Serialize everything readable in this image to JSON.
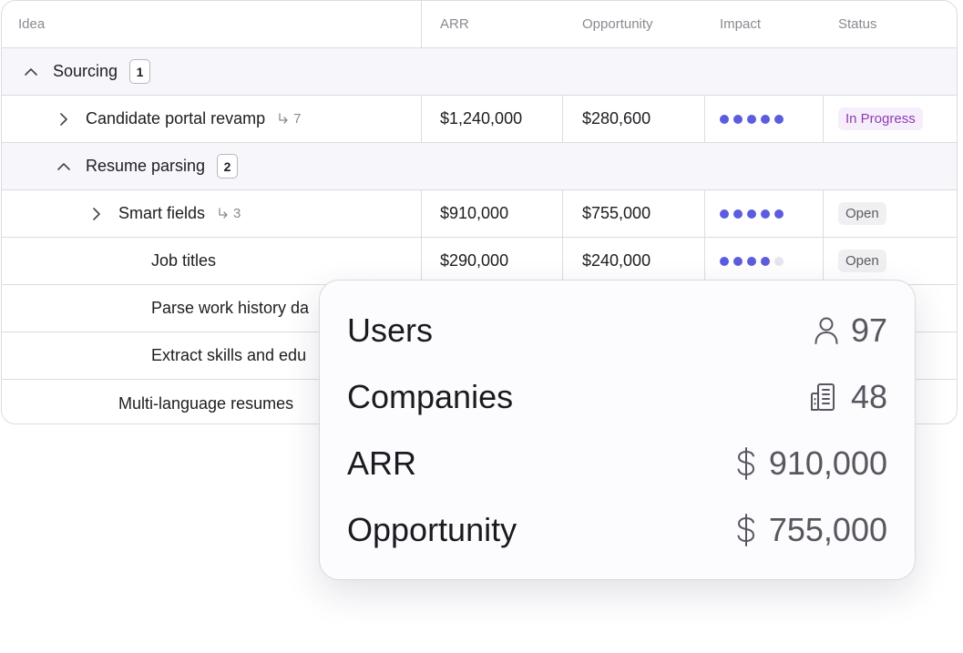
{
  "columns": {
    "idea": "Idea",
    "arr": "ARR",
    "opportunity": "Opportunity",
    "impact": "Impact",
    "status": "Status"
  },
  "rows": [
    {
      "type": "group",
      "label": "Sourcing",
      "count": "1",
      "expanded": true
    },
    {
      "type": "item",
      "label": "Candidate portal revamp",
      "subcount": "7",
      "arr": "$1,240,000",
      "opportunity": "$280,600",
      "impact": 5,
      "status": "In Progress"
    },
    {
      "type": "group",
      "label": "Resume parsing",
      "count": "2",
      "expanded": true
    },
    {
      "type": "item",
      "label": "Smart fields",
      "subcount": "3",
      "arr": "$910,000",
      "opportunity": "$755,000",
      "impact": 5,
      "status": "Open"
    },
    {
      "type": "item",
      "label": "Job titles",
      "arr": "$290,000",
      "opportunity": "$240,000",
      "impact": 4,
      "status": "Open"
    },
    {
      "type": "item",
      "label": "Parse work history da"
    },
    {
      "type": "item",
      "label": "Extract skills and edu"
    },
    {
      "type": "item",
      "label": "Multi-language resumes"
    }
  ],
  "popover": {
    "users_label": "Users",
    "users_value": "97",
    "users_icon": "user-icon",
    "companies_label": "Companies",
    "companies_value": "48",
    "companies_icon": "building-icon",
    "arr_label": "ARR",
    "arr_value": "910,000",
    "arr_icon": "dollar-icon",
    "opportunity_label": "Opportunity",
    "opportunity_value": "755,000",
    "opportunity_icon": "dollar-icon"
  },
  "colors": {
    "impact_dot": "#5b5ce0",
    "impact_dot_off": "#e5e4ef",
    "status_in_progress": "#8f3db3",
    "status_open": "#5b5b63"
  }
}
